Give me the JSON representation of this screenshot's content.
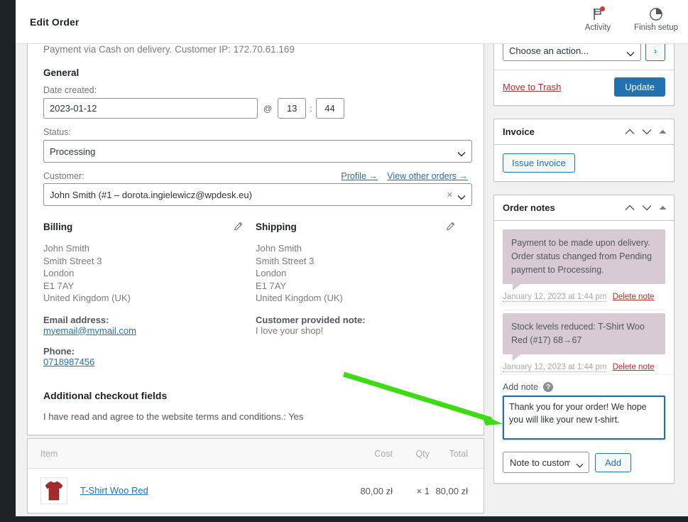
{
  "topbar": {
    "title": "Edit Order",
    "actions": [
      {
        "label": "Activity",
        "icon": "flag-icon"
      },
      {
        "label": "Finish setup",
        "icon": "pie-progress-icon"
      }
    ]
  },
  "order": {
    "payment_line": "Payment via Cash on delivery. Customer IP: 172.70.61.169",
    "general_heading": "General",
    "date_label": "Date created:",
    "date_value": "2023-01-12",
    "at_sign": "@",
    "hour_value": "13",
    "colon": ":",
    "minute_value": "44",
    "status_label": "Status:",
    "status_value": "Processing",
    "customer_label": "Customer:",
    "customer_value": "John Smith (#1 – dorota.ingielewicz@wpdesk.eu)",
    "profile_link": "Profile →",
    "other_orders_link": "View other orders →"
  },
  "billing": {
    "heading": "Billing",
    "lines": [
      "John Smith",
      "Smith Street 3",
      "London",
      "E1 7AY",
      "United Kingdom (UK)"
    ],
    "email_label": "Email address:",
    "email_value": "myemail@mymail.com",
    "phone_label": "Phone:",
    "phone_value": "0718987456"
  },
  "shipping": {
    "heading": "Shipping",
    "lines": [
      "John Smith",
      "Smith Street 3",
      "London",
      "E1 7AY",
      "United Kingdom (UK)"
    ],
    "note_label": "Customer provided note:",
    "note_value": "I love your shop!"
  },
  "additional_fields": {
    "heading": "Additional checkout fields",
    "line": "I have read and agree to the website terms and conditions.: Yes"
  },
  "items": {
    "columns": {
      "item": "Item",
      "cost": "Cost",
      "qty": "Qty",
      "total": "Total"
    },
    "rows": [
      {
        "name": "T-Shirt Woo Red",
        "cost": "80,00 zł",
        "qty": "× 1",
        "total": "80,00 zł"
      }
    ]
  },
  "sidebar": {
    "actions_panel": {
      "action_select_value": "Choose an action...",
      "go_label": "›",
      "trash_label": "Move to Trash",
      "update_label": "Update"
    },
    "invoice_panel": {
      "title": "Invoice",
      "issue_label": "Issue Invoice"
    },
    "notes_panel": {
      "title": "Order notes",
      "notes": [
        {
          "text": "Payment to be made upon delivery. Order status changed from Pending payment to Processing.",
          "date": "January 12, 2023 at 1:44 pm",
          "delete_label": "Delete note"
        },
        {
          "text": "Stock levels reduced: T-Shirt Woo Red (#17) 68→67",
          "date": "January 12, 2023 at 1:44 pm",
          "delete_label": "Delete note"
        }
      ],
      "add_note_label": "Add note",
      "help_glyph": "?",
      "note_value": "Thank you for your order! We hope you will like your new t-shirt.",
      "note_type_value": "Note to customer",
      "add_label": "Add"
    }
  },
  "colors": {
    "accent_blue": "#2271b1",
    "danger_red": "#b32d2e",
    "note_bubble": "#d7cad2",
    "admin_dark": "#1d2327",
    "arrow_green": "#3ddb11"
  }
}
